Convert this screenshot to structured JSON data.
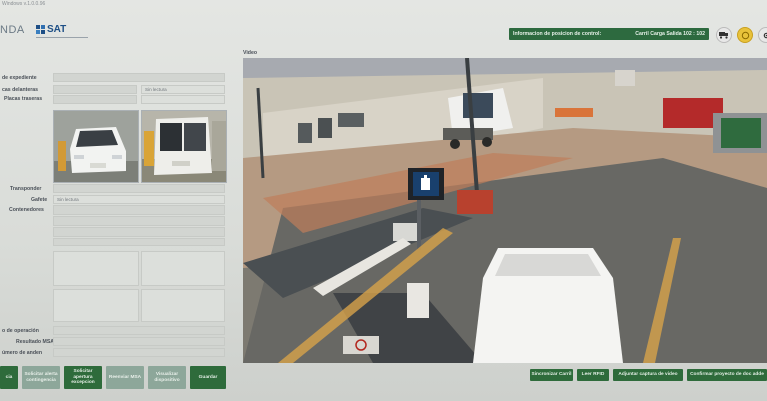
{
  "app": {
    "version": "Windows v.1.0.0.96",
    "brand_left": "NDA",
    "logo_text": "SAT"
  },
  "control_banner": {
    "title": "Informacion de posicion de control:",
    "value": "Carril Carga Salida 102  :  102"
  },
  "form": {
    "expediente_label": "de expediente",
    "placas_delanteras_label": "cas delanteras",
    "placas_traseras_label": "Placas traseras",
    "placas_delanteras_status": "Sin lectura",
    "transponder_label": "Transponder",
    "gafete_label": "Gafete",
    "gafete_value": "Sin lectura",
    "contenedores_label": "Contenedores",
    "tipo_operacion_label": "o de operación",
    "resultado_msa_label": "Resultado MSA",
    "numero_anden_label": "úmero de anden"
  },
  "video": {
    "label": "Video"
  },
  "left_buttons": [
    {
      "label": "cia",
      "enabled": true
    },
    {
      "label": "Solicitar alerta contingencia",
      "enabled": false
    },
    {
      "label": "Solicitar apertura excepcion",
      "enabled": true
    },
    {
      "label": "Reenviar MSA",
      "enabled": false
    },
    {
      "label": "Visualizar dispositivo",
      "enabled": false
    },
    {
      "label": "Guardar",
      "enabled": true
    }
  ],
  "right_buttons": [
    {
      "label": "Sincronizar Carril"
    },
    {
      "label": "Leer RFID"
    },
    {
      "label": "Adjuntar captura de video"
    },
    {
      "label": "Confirmar proyecto de doc adde"
    }
  ],
  "icons": [
    "truck-icon",
    "coin-icon",
    "gear-icon",
    "hand-sign-icon"
  ]
}
